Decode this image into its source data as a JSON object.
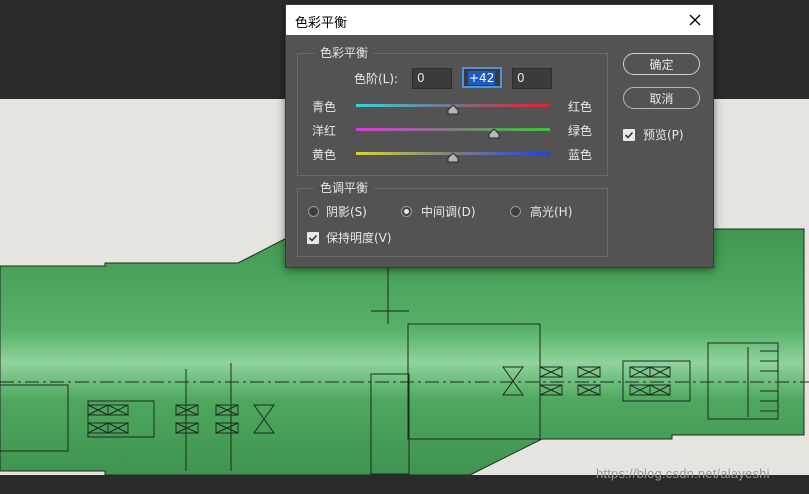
{
  "dialog": {
    "title": "色彩平衡",
    "color_balance": {
      "legend": "色彩平衡",
      "levels_label": "色阶(L):",
      "levels": [
        "0",
        "+42",
        "0"
      ],
      "sliders": [
        {
          "left": "青色",
          "right": "红色",
          "value": 0
        },
        {
          "left": "洋红",
          "right": "绿色",
          "value": 42
        },
        {
          "left": "黄色",
          "right": "蓝色",
          "value": 0
        }
      ]
    },
    "tone_balance": {
      "legend": "色调平衡",
      "options": [
        "阴影(S)",
        "中间调(D)",
        "高光(H)"
      ],
      "selected": "中间调(D)",
      "preserve_luminosity": {
        "label": "保持明度(V)",
        "checked": true
      }
    },
    "buttons": {
      "ok": "确定",
      "cancel": "取消"
    },
    "preview": {
      "label": "预览(P)",
      "checked": true
    }
  },
  "watermark": "https://blog.csdn.net/alayeshi",
  "colors": {
    "dialog_bg": "#535353",
    "canvas_bg": "#e5e4df",
    "dark_bg": "#2b2b2b",
    "part_fill": "#4fa85f",
    "accent": "#1e5bbd"
  }
}
